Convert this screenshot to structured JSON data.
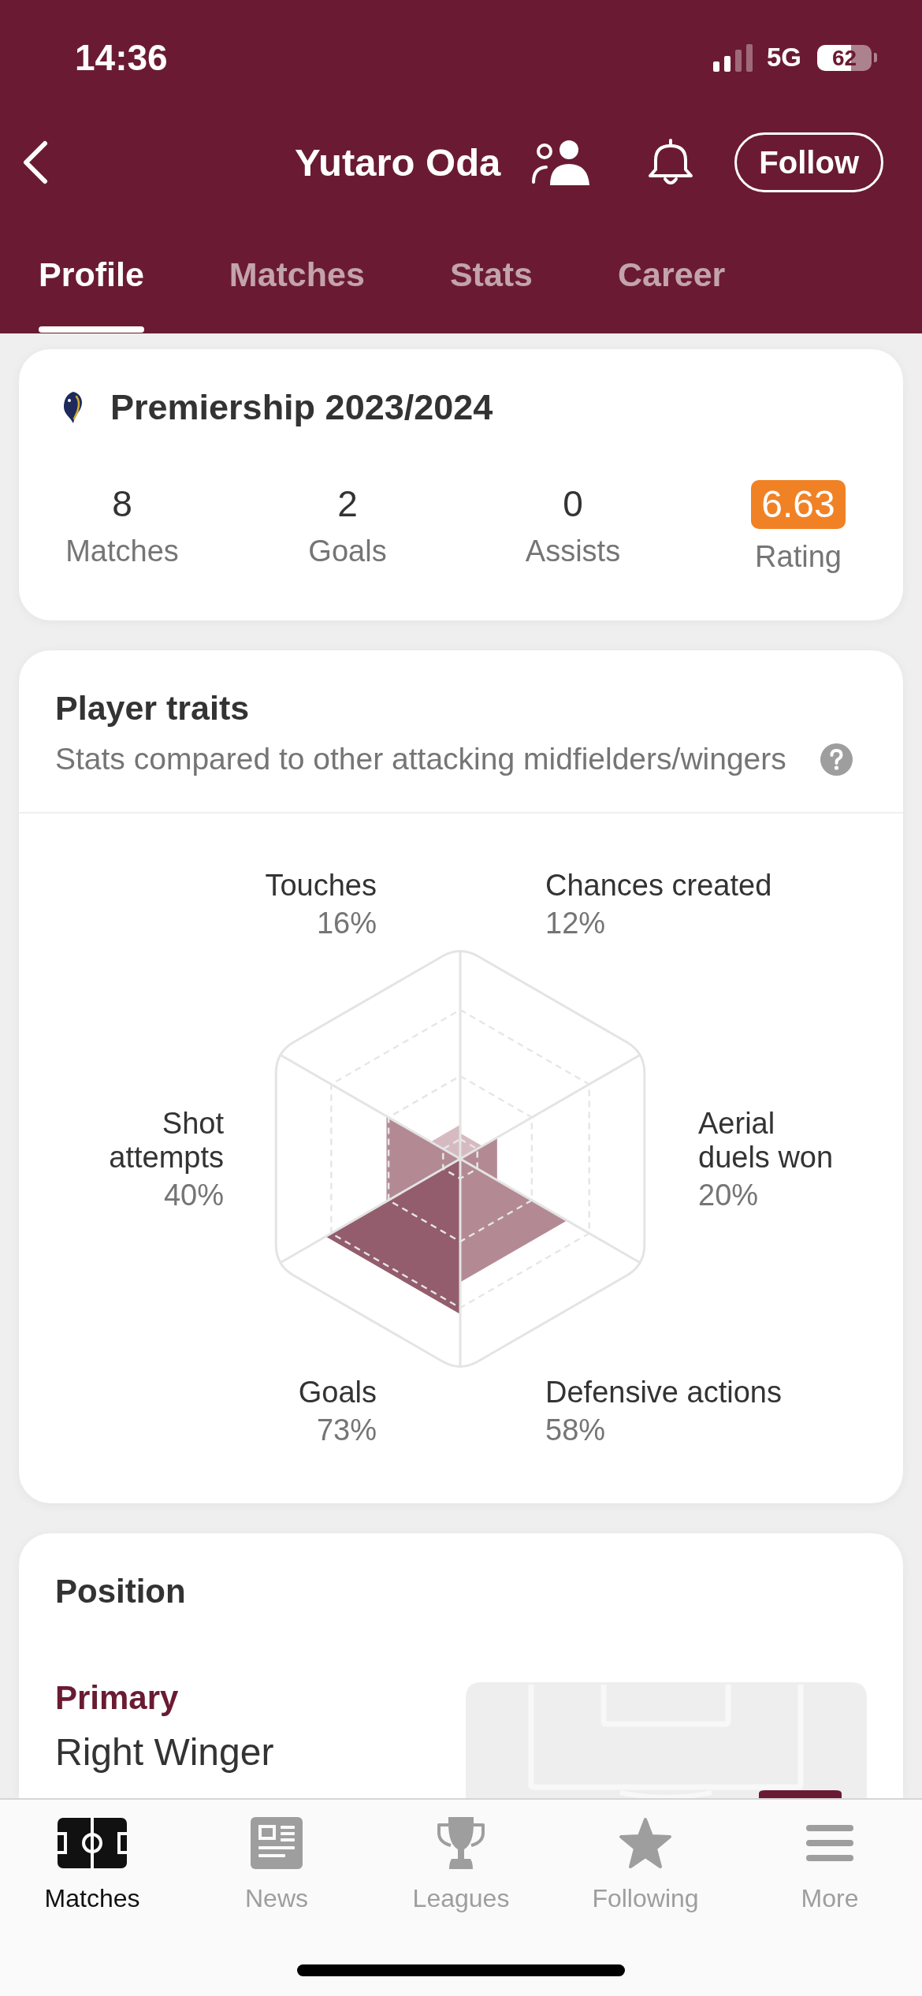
{
  "status_bar": {
    "time": "14:36",
    "network": "5G",
    "battery": "62"
  },
  "header": {
    "title": "Yutaro Oda",
    "follow_button": "Follow"
  },
  "tabs": [
    {
      "label": "Profile",
      "selected": true
    },
    {
      "label": "Matches",
      "selected": false
    },
    {
      "label": "Stats",
      "selected": false
    },
    {
      "label": "Career",
      "selected": false
    }
  ],
  "season_card": {
    "title": "Premiership 2023/2024",
    "stats": [
      {
        "kind": "plain",
        "value": "8",
        "label": "Matches"
      },
      {
        "kind": "plain",
        "value": "2",
        "label": "Goals"
      },
      {
        "kind": "plain",
        "value": "0",
        "label": "Assists"
      },
      {
        "kind": "badge",
        "value": "6.63",
        "label": "Rating"
      }
    ]
  },
  "player_traits": {
    "title": "Player traits",
    "subtitle": "Stats compared to other attacking midfielders/wingers",
    "traits": [
      {
        "label": "Touches",
        "value": "16%"
      },
      {
        "label": "Chances created",
        "value": "12%"
      },
      {
        "label": "Shot attempts",
        "value": "40%"
      },
      {
        "label": "Aerial duels won",
        "value": "20%"
      },
      {
        "label": "Goals",
        "value": "73%"
      },
      {
        "label": "Defensive actions",
        "value": "58%"
      }
    ]
  },
  "position_card": {
    "title": "Position",
    "primary_label": "Primary",
    "primary_position": "Right Winger"
  },
  "bottom_nav": [
    {
      "label": "Matches",
      "selected": true
    },
    {
      "label": "News",
      "selected": false
    },
    {
      "label": "Leagues",
      "selected": false
    },
    {
      "label": "Following",
      "selected": false
    },
    {
      "label": "More",
      "selected": false
    }
  ]
}
